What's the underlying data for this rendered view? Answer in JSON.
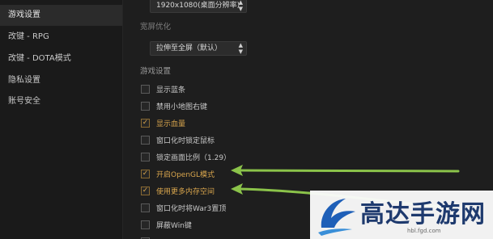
{
  "sidebar": {
    "items": [
      {
        "label": "游戏设置",
        "active": true
      },
      {
        "label": "改键 - RPG",
        "active": false
      },
      {
        "label": "改键 - DOTA模式",
        "active": false
      },
      {
        "label": "隐私设置",
        "active": false
      },
      {
        "label": "账号安全",
        "active": false
      }
    ]
  },
  "display": {
    "resolution_value": "1920x1080(桌面分辨率)",
    "widescreen_label": "宽屏优化",
    "widescreen_value": "拉伸至全屏（默认）"
  },
  "game_settings": {
    "label": "游戏设置",
    "options": [
      {
        "label": "显示蓝条",
        "checked": false
      },
      {
        "label": "禁用小地图右键",
        "checked": false
      },
      {
        "label": "显示血量",
        "checked": true
      },
      {
        "label": "窗口化时锁定鼠标",
        "checked": false
      },
      {
        "label": "锁定画面比例（1.29）",
        "checked": false
      },
      {
        "label": "开启OpenGL模式",
        "checked": true
      },
      {
        "label": "使用更多内存空间",
        "checked": true
      },
      {
        "label": "窗口化时将War3置顶",
        "checked": false
      },
      {
        "label": "屏蔽Win键",
        "checked": false
      }
    ]
  },
  "watermark": {
    "text": "高达手游网",
    "url": "hbl.fgd.com"
  },
  "colors": {
    "accent": "#d9a64d",
    "arrow": "#8bc34a",
    "brand": "#1e3a6e"
  }
}
